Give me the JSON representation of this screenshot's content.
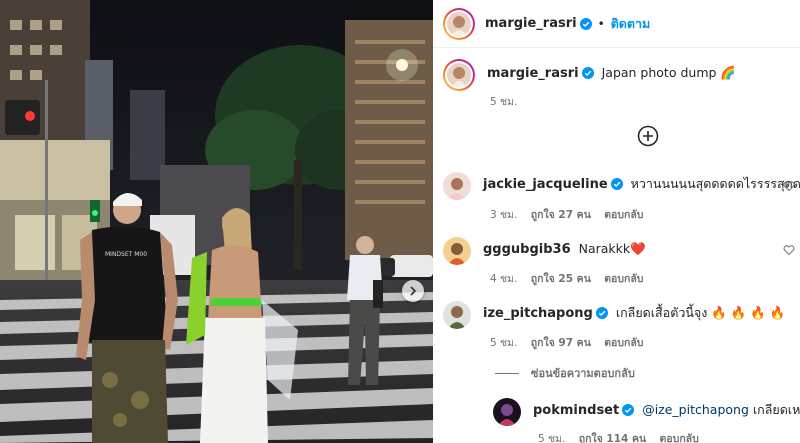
{
  "post": {
    "author": "margie_rasri",
    "follow_label": "ติดตาม",
    "separator": "•",
    "caption": "Japan photo dump 🌈",
    "caption_time": "5 ชม."
  },
  "photo": {
    "shirt_text": "MINDSET M00"
  },
  "comments": [
    {
      "username": "jackie_jacqueline",
      "text": "หวานนนนนสุดดดดดไรรรรสุดดดด",
      "time": "3 ชม.",
      "likes": "ถูกใจ 27 คน",
      "reply": "ตอบกลับ"
    },
    {
      "username": "gggubgib36",
      "text": "Narakkk❤️",
      "time": "4 ชม.",
      "likes": "ถูกใจ 25 คน",
      "reply": "ตอบกลับ"
    },
    {
      "username": "ize_pitchapong",
      "text": "เกลียดเสื้อตัวนี้จุง 🔥 🔥 🔥 🔥",
      "time": "5 ชม.",
      "likes": "ถูกใจ 97 คน",
      "reply": "ตอบกลับ"
    }
  ],
  "hide_replies_label": "ซ่อนข้อความตอบกลับ",
  "reply": {
    "username": "pokmindset",
    "mention": "@ize_pitchapong",
    "text": " เกลียดเหมือนกั",
    "time": "5 ชม.",
    "likes": "ถูกใจ 114 คน",
    "reply": "ตอบกลับ"
  },
  "colors": {
    "accent": "#0095f6",
    "verified": "#0095f6",
    "muted": "#737373",
    "text": "#262626"
  },
  "icons": [
    "verified-badge-icon",
    "add-comment-icon",
    "heart-icon",
    "next-arrow-icon"
  ]
}
